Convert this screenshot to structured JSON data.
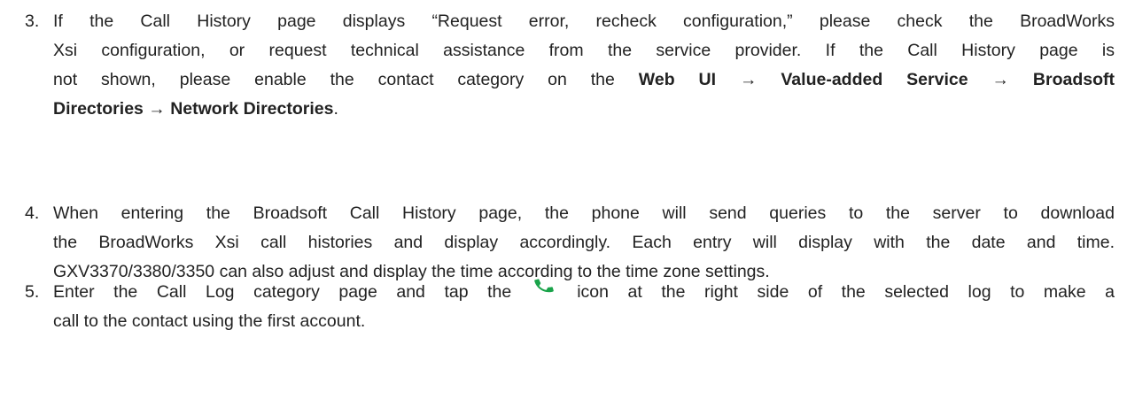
{
  "steps": [
    {
      "number": "3.",
      "lines": [
        {
          "parts": [
            {
              "t": "If the Call History page displays “Request error, recheck configuration,” please check the BroadWorks",
              "b": false
            }
          ]
        },
        {
          "parts": [
            {
              "t": "Xsi configuration, or request technical assistance from the service provider. If the Call History page is",
              "b": false
            }
          ]
        },
        {
          "parts": [
            {
              "t": "not shown, please enable the contact category on the ",
              "b": false
            },
            {
              "t": "Web UI → Value-added Service → Broadsoft",
              "b": true
            }
          ]
        },
        {
          "parts": [
            {
              "t": "Directories → Network Directories",
              "b": true
            },
            {
              "t": ".",
              "b": false
            }
          ]
        }
      ]
    },
    {
      "number": "4.",
      "lines": [
        {
          "parts": [
            {
              "t": "When entering the Broadsoft Call History page, the phone will send queries to the server to download",
              "b": false
            }
          ]
        },
        {
          "parts": [
            {
              "t": "the BroadWorks Xsi call histories and display accordingly. Each entry will display with the date and time.",
              "b": false
            }
          ]
        },
        {
          "parts": [
            {
              "t": "GXV3370/3380/3350 can also adjust and display the time according to the time zone settings.",
              "b": false
            }
          ]
        }
      ]
    },
    {
      "number": "5.",
      "line1_before_icon": "Enter the Call Log category page and tap the",
      "line1_after_icon": "icon at the right side of the selected log to make a",
      "line2": "call to the contact using the first account.",
      "icon": "phone-call-icon",
      "icon_color": "#1aa34a"
    }
  ]
}
